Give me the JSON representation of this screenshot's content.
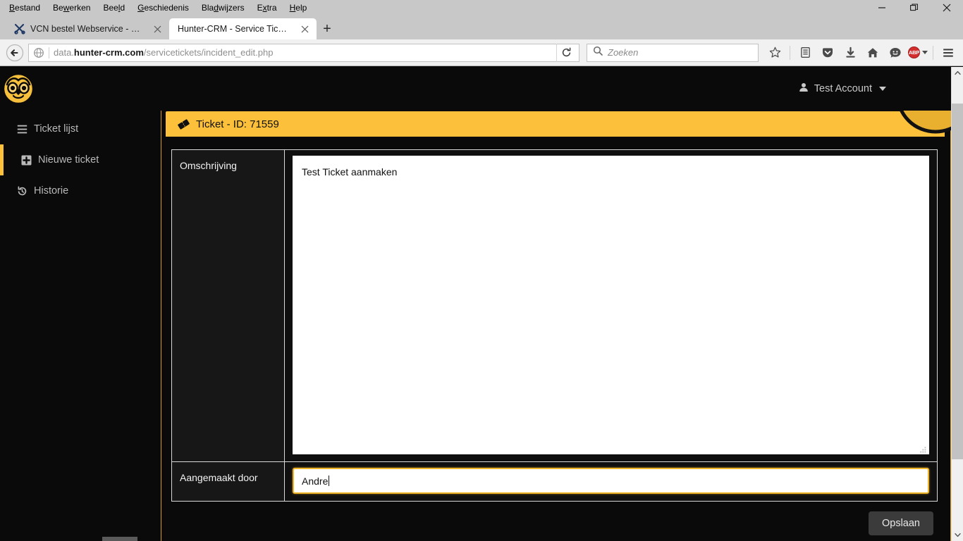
{
  "browser": {
    "menus": [
      {
        "label": "Bestand",
        "accel": "B"
      },
      {
        "label": "Bewerken",
        "accel": "w"
      },
      {
        "label": "Beeld",
        "accel": "l"
      },
      {
        "label": "Geschiedenis",
        "accel": "G"
      },
      {
        "label": "Bladwijzers",
        "accel": "d"
      },
      {
        "label": "Extra",
        "accel": "x"
      },
      {
        "label": "Help",
        "accel": "H"
      }
    ],
    "window_controls": {
      "minimize": "minimize-icon",
      "restore": "restore-icon",
      "close": "close-icon"
    },
    "tabs": [
      {
        "title": "VCN bestel Webservice - V...",
        "active": false,
        "favicon": "tools-favicon"
      },
      {
        "title": "Hunter-CRM - Service Tickets",
        "active": true,
        "favicon": "none"
      }
    ],
    "new_tab_label": "+",
    "url": {
      "prefix": "data.",
      "domain": "hunter-crm.com",
      "path": "/servicetickets/incident_edit.php"
    },
    "reload_label": "reload-icon",
    "search": {
      "placeholder": "Zoeken",
      "icon": "search-icon"
    },
    "toolbar_icons": [
      "star-icon",
      "library-icon",
      "pocket-icon",
      "downloads-icon",
      "home-icon",
      "feedback-smiley-icon",
      "adblock-plus-icon",
      "hamburger-menu-icon"
    ],
    "adblock_label": "ABP"
  },
  "app": {
    "logo": "owl-logo",
    "account": {
      "name": "Test Account",
      "icon": "user-icon",
      "caret": "caret-down-icon"
    },
    "sidebar": [
      {
        "label": "Ticket lijst",
        "icon": "list-bars-icon",
        "active": false
      },
      {
        "label": "Nieuwe ticket",
        "icon": "plus-square-icon",
        "active": true
      },
      {
        "label": "Historie",
        "icon": "history-icon",
        "active": false
      }
    ],
    "panel": {
      "icon": "ticket-icon",
      "title": "Ticket - ID: 71559"
    },
    "form": {
      "rows": [
        {
          "label": "Omschrijving",
          "value": "Test Ticket aanmaken",
          "type": "textarea",
          "placeholder": ""
        },
        {
          "label": "Aangemaakt door",
          "value": "Andre",
          "type": "text",
          "placeholder": "",
          "focused": true
        }
      ],
      "save_label": "Opslaan"
    }
  },
  "colors": {
    "accent": "#fcc03a",
    "accent_border": "#d79b1e",
    "page_bg": "#0a0a0a",
    "label_cell": "#171717",
    "save_btn": "#3b3b3b"
  },
  "scrollbar": {
    "up": "scroll-up-arrow",
    "down": "scroll-down-arrow"
  }
}
